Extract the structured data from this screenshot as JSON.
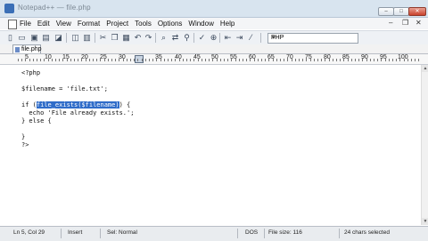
{
  "window": {
    "title": "Notepad++ — file.php",
    "controls": {
      "minimize": "–",
      "maximize": "□",
      "close": "✕"
    }
  },
  "menu": {
    "items": [
      "File",
      "Edit",
      "View",
      "Format",
      "Project",
      "Tools",
      "Options",
      "Window",
      "Help"
    ],
    "right_controls": {
      "minimize": "–",
      "restore": "❐",
      "close": "✕"
    }
  },
  "toolbar": {
    "icons": [
      "new-file-icon",
      "open-folder-icon",
      "save-icon",
      "save-all-icon",
      "open-icon",
      "print-preview-icon",
      "print-icon",
      "cut-icon",
      "copy-icon",
      "paste-icon",
      "undo-icon",
      "redo-icon",
      "find-icon",
      "replace-icon",
      "find-in-files-icon",
      "spell-check-icon",
      "zoom-icon",
      "outdent-icon",
      "indent-icon",
      "comment-icon"
    ],
    "language": "PHP"
  },
  "tab": {
    "label": "file.php"
  },
  "ruler": {
    "labels": [
      "5",
      "10",
      "15",
      "20",
      "25",
      "30",
      "35",
      "40",
      "45",
      "50",
      "55",
      "60",
      "65",
      "70",
      "75",
      "80",
      "85",
      "90",
      "95",
      "100"
    ]
  },
  "code": {
    "line1": "<?php",
    "line2": "$filename = 'file.txt';",
    "line3_pre": "if (",
    "line3_hl": "file_exists($filename)",
    "line3_post": ") {",
    "line4": "  echo 'File already exists.';",
    "line5": "} else {",
    "line6": "}",
    "line7": "?>"
  },
  "status": {
    "position": "Ln 5, Col 29",
    "insert_mode": "Insert",
    "selection_mode": "Sel: Normal",
    "line_ending": "DOS",
    "file_size": "File size: 116",
    "selection_count": "24 chars selected"
  }
}
